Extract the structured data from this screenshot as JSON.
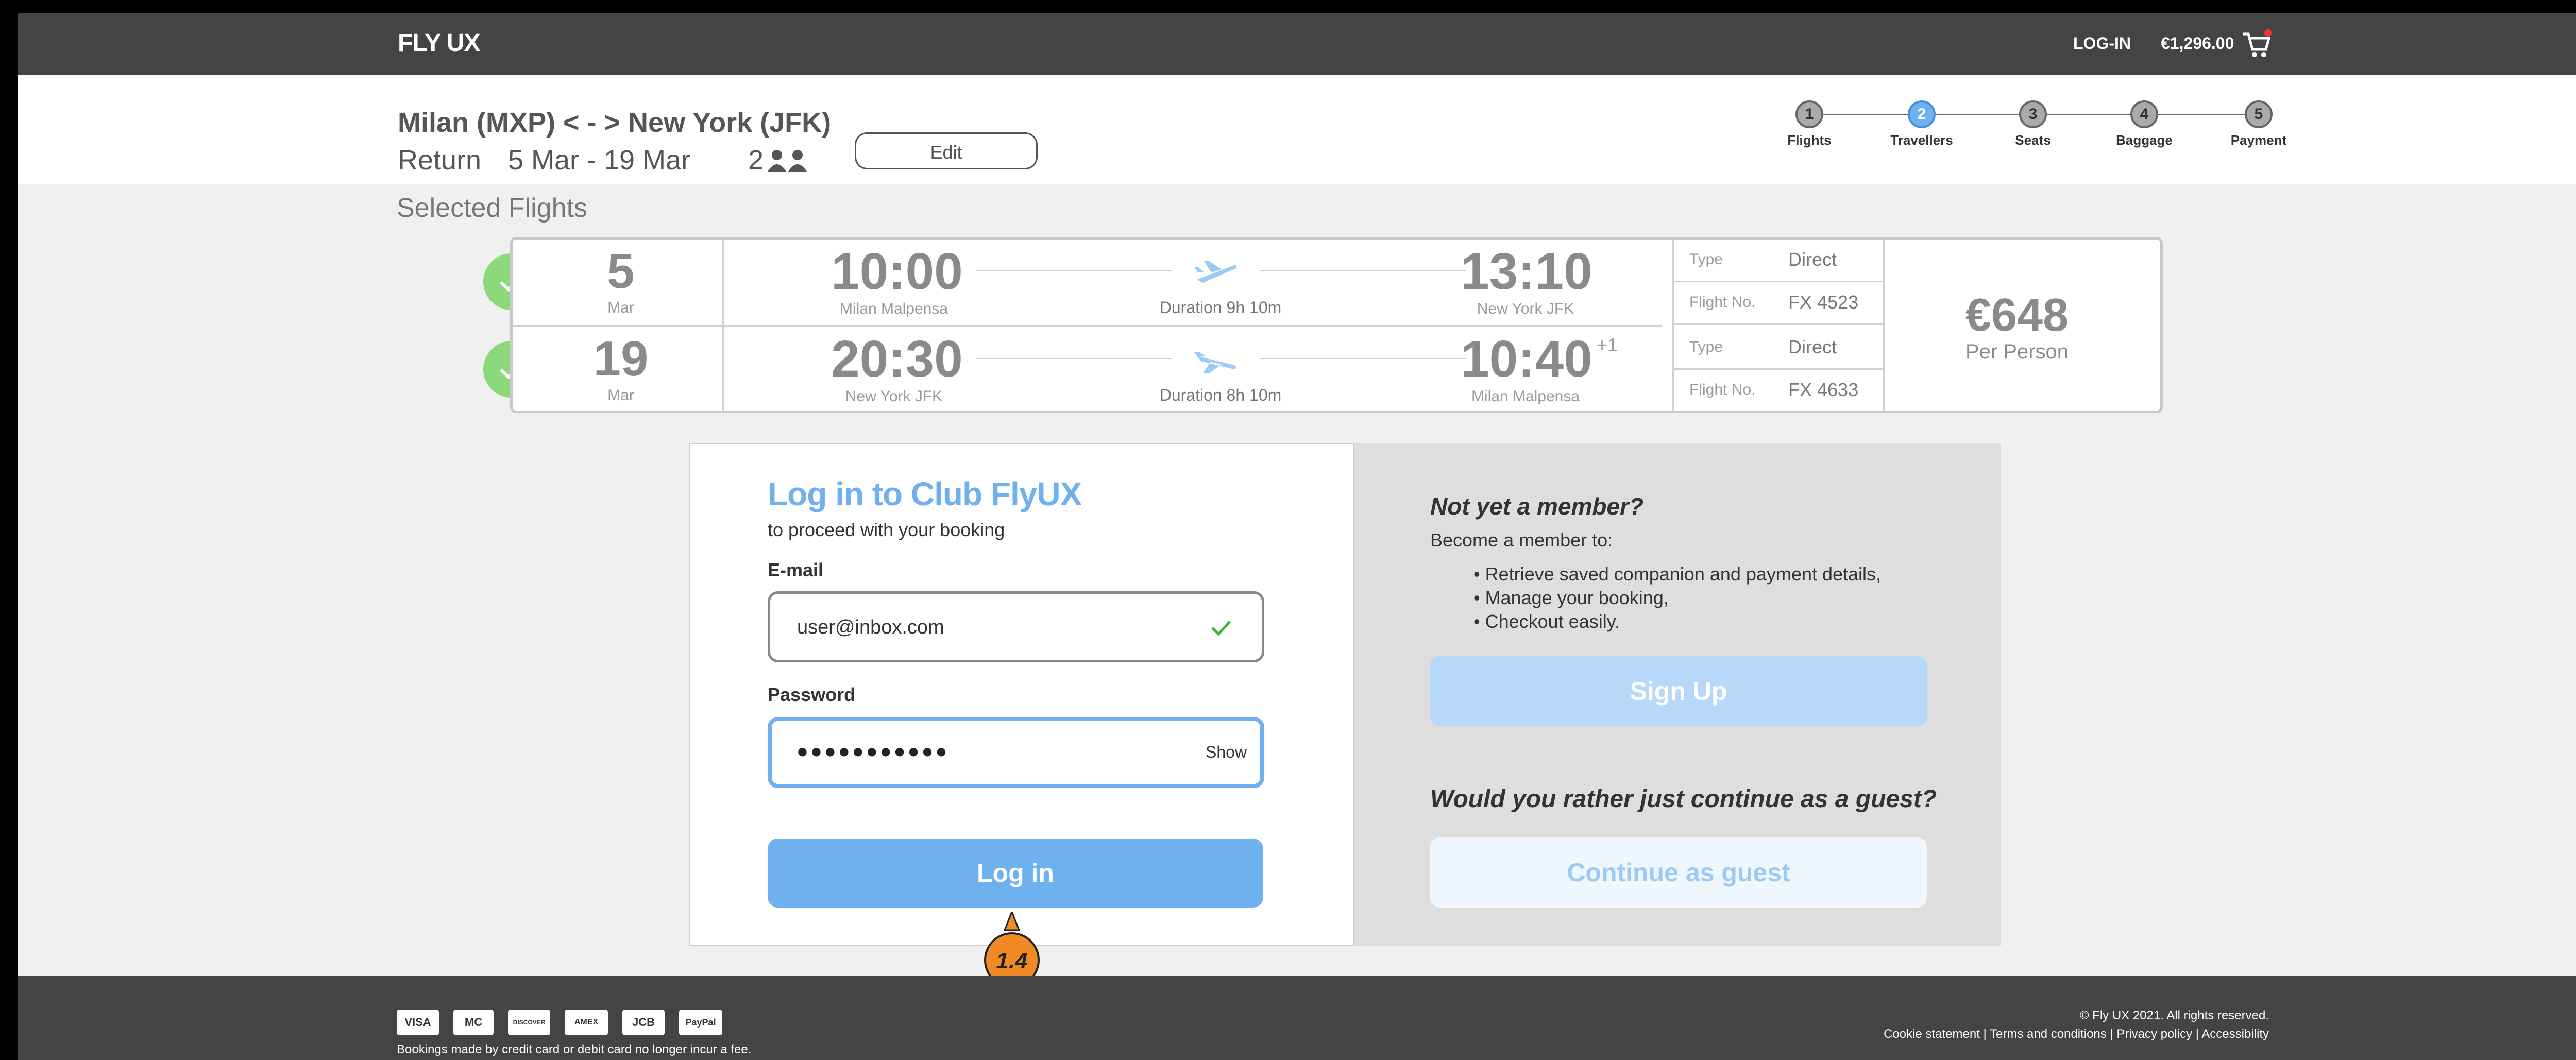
{
  "header": {
    "logo": "FLY UX",
    "login": "LOG-IN",
    "cart_total": "€1,296.00"
  },
  "trip": {
    "route": "Milan (MXP) < - > New York (JFK)",
    "type": "Return",
    "dates": "5 Mar - 19 Mar",
    "travellers": "2",
    "edit_label": "Edit"
  },
  "steps": [
    {
      "num": "1",
      "label": "Flights"
    },
    {
      "num": "2",
      "label": "Travellers"
    },
    {
      "num": "3",
      "label": "Seats"
    },
    {
      "num": "4",
      "label": "Baggage"
    },
    {
      "num": "5",
      "label": "Payment"
    }
  ],
  "active_step": "2",
  "selected_title": "Selected Flights",
  "flights": [
    {
      "day": "5",
      "month": "Mar",
      "dep_time": "10:00",
      "dep_city": "Milan Malpensa",
      "duration": "Duration 9h 10m",
      "arr_time": "13:10",
      "arr_city": "New York JFK",
      "arr_plus": "",
      "type_label": "Type",
      "type": "Direct",
      "flight_label": "Flight No.",
      "flight_no": "FX 4523"
    },
    {
      "day": "19",
      "month": "Mar",
      "dep_time": "20:30",
      "dep_city": "New York JFK",
      "duration": "Duration 8h 10m",
      "arr_time": "10:40",
      "arr_city": "Milan Malpensa",
      "arr_plus": "+1",
      "type_label": "Type",
      "type": "Direct",
      "flight_label": "Flight No.",
      "flight_no": "FX 4633"
    }
  ],
  "price": {
    "amount": "€648",
    "per": "Per Person"
  },
  "login": {
    "title": "Log in to Club FlyUX",
    "subtitle": "to proceed with your booking",
    "email_label": "E-mail",
    "email_value": "user@inbox.com",
    "password_label": "Password",
    "password_value": "●●●●●●●●●●●",
    "show_label": "Show",
    "button": "Log in"
  },
  "annotation": "1.4",
  "member": {
    "title": "Not yet a member?",
    "subtitle": "Become a member to:",
    "benefits": [
      "Retrieve saved companion and payment details,",
      "Manage your booking,",
      "Checkout easily."
    ],
    "signup": "Sign Up",
    "guest_question": "Would you rather just continue as a guest?",
    "guest_button": "Continue as guest"
  },
  "footer": {
    "cards": [
      "VISA",
      "MC",
      "DISCOVER",
      "AMEX",
      "JCB",
      "PayPal"
    ],
    "fee_note": "Bookings made by credit card or debit card no longer incur a fee.",
    "copyright": "© Fly UX 2021. All rights reserved.",
    "links": "Cookie statement | Terms and conditions | Privacy policy | Accessibility"
  },
  "colors": {
    "accent": "#6fb0ee",
    "check": "#8bd97a",
    "topbar": "#444444",
    "annotation": "#f08a24"
  }
}
